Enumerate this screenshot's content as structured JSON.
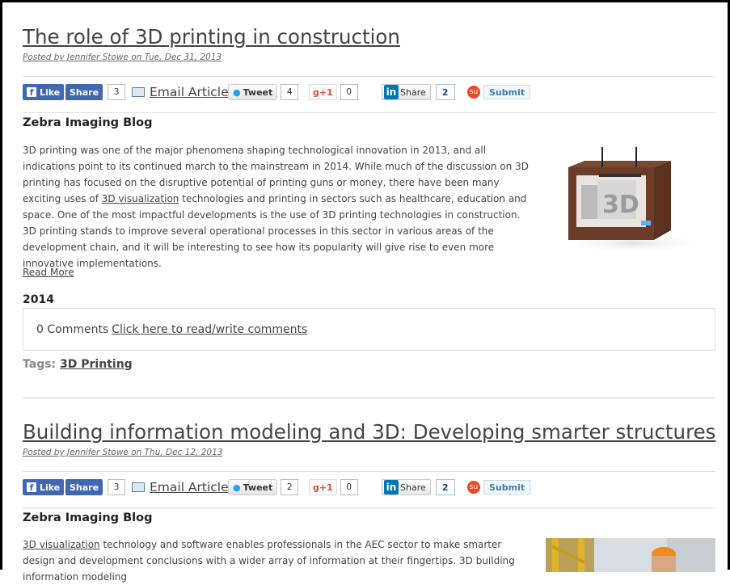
{
  "posts": [
    {
      "title": "The role of 3D printing in construction",
      "meta": "Posted by Jennifer Stowe on Tue, Dec 31, 2013",
      "share": {
        "like": "Like",
        "share": "Share",
        "fb_count": "3",
        "email": "Email Article",
        "tweet": "Tweet",
        "tweet_count": "4",
        "gplus": "+1",
        "gplus_count": "0",
        "li_share": "Share",
        "li_count": "2",
        "submit": "Submit"
      },
      "blog": "Zebra Imaging Blog",
      "text_parts": [
        "3D printing was one of the major phenomena shaping technological innovation in 2013, and all indications point to its continued march to the mainstream in 2014. While much of the discussion on 3D printing has focused on the disruptive potential of printing guns or money, there have been many exciting uses of ",
        "3D visualization",
        " technologies and printing in sectors such as healthcare, education and space. One of the most impactful developments is the use of 3D printing technologies in construction. 3D printing stands to improve several operational processes in this sector in various areas of the development chain, and it will be interesting to see how its popularity will give rise to even more innovative implementations."
      ],
      "read_more": "Read More",
      "year": "2014",
      "comments_count": "0 Comments",
      "comments_link": "Click here to read/write comments",
      "tags_label": "Tags:",
      "tag": "3D Printing"
    },
    {
      "title": "Building information modeling and 3D: Developing smarter structures",
      "meta": "Posted by Jennifer Stowe on Thu, Dec 12, 2013",
      "share": {
        "like": "Like",
        "share": "Share",
        "fb_count": "3",
        "email": "Email Article",
        "tweet": "Tweet",
        "tweet_count": "2",
        "gplus": "+1",
        "gplus_count": "0",
        "li_share": "Share",
        "li_count": "2",
        "submit": "Submit"
      },
      "blog": "Zebra Imaging Blog",
      "text_parts": [
        "3D visualization",
        " technology and software enables professionals in the AEC sector to make smarter design and development conclusions with a wider array of information at their fingertips. 3D building information modeling"
      ]
    }
  ],
  "icons": {
    "facebook": "facebook-icon",
    "email": "email-icon",
    "twitter": "twitter-icon",
    "linkedin": "linkedin-icon",
    "stumbleupon": "stumbleupon-icon"
  },
  "colors": {
    "facebook": "#4267b2",
    "linkedin": "#0077b5",
    "stumbleupon": "#eb4924",
    "twitter": "#1da1f2",
    "gplus": "#dd4b39"
  }
}
